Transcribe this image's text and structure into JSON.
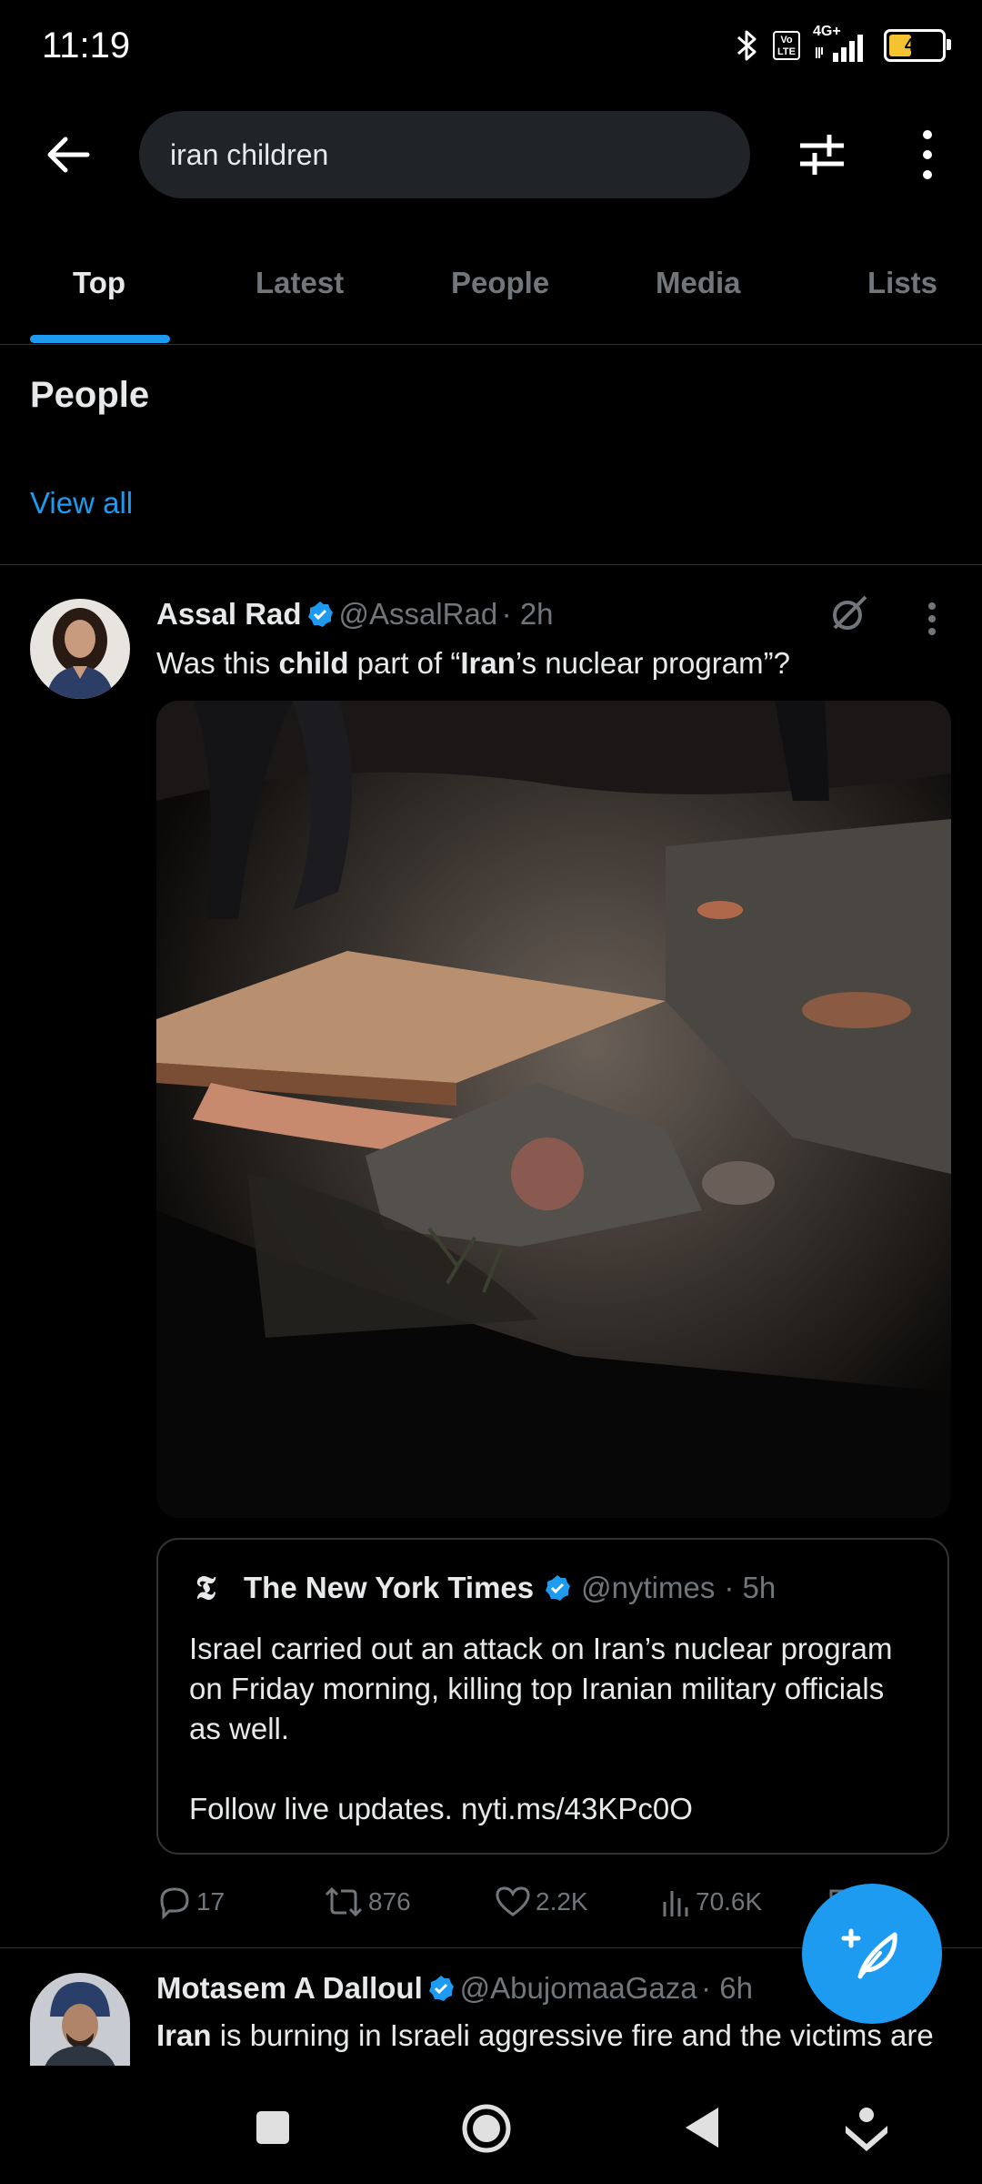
{
  "status_bar": {
    "time": "11:19",
    "volte_label": "Vo LTE",
    "network_label": "4G+",
    "battery": "49",
    "battery_level": 0.49
  },
  "search": {
    "query": "iran children",
    "back_icon": "arrow-left-icon",
    "filter_icon": "sliders-icon",
    "more_icon": "more-vertical-icon"
  },
  "tabs": [
    {
      "label": "Top"
    },
    {
      "label": "Latest"
    },
    {
      "label": "People"
    },
    {
      "label": "Media"
    },
    {
      "label": "Lists"
    }
  ],
  "people_section": {
    "title": "People",
    "view_all": "View all"
  },
  "tweet1": {
    "name": "Assal Rad",
    "handle": "@AssalRad",
    "time": "· 2h",
    "text_parts": [
      "Was this ",
      "child",
      " part of “",
      "Iran",
      "’s nuclear program”?"
    ],
    "quote": {
      "name": "The New York Times",
      "handle": "@nytimes",
      "time": "· 5h",
      "text": "Israel carried out an attack on Iran’s nuclear program on Friday morning, killing top Iranian military officials as well.\n\nFollow live updates. nyti.ms/43KPc0O"
    },
    "actions": {
      "replies": "17",
      "reposts": "876",
      "likes": "2.2K",
      "views": "70.6K"
    }
  },
  "tweet2": {
    "name": "Motasem A Dalloul",
    "handle": "@AbujomaaGaza",
    "time": "· 6h",
    "text_parts": [
      "Iran",
      " is burning in Israeli aggressive fire and the victims are"
    ]
  },
  "colors": {
    "accent": "#1d9bf0",
    "background": "#000000",
    "secondary_text": "#71767b"
  }
}
